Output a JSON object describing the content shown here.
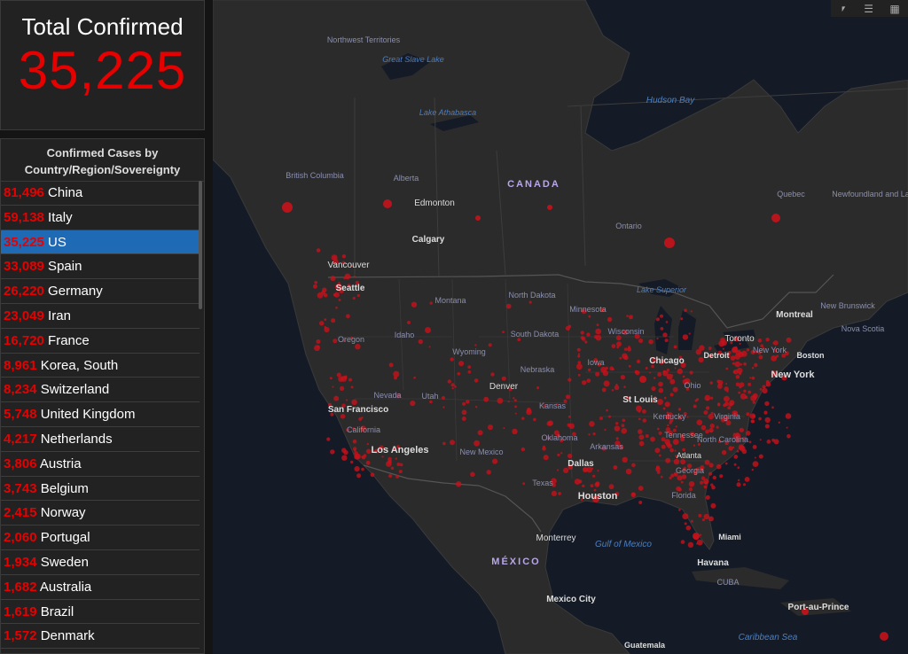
{
  "total": {
    "title": "Total Confirmed",
    "value": "35,225"
  },
  "list": {
    "header": "Confirmed Cases by Country/Region/Sovereignty",
    "rows": [
      {
        "value": "81,496",
        "name": "China"
      },
      {
        "value": "59,138",
        "name": "Italy"
      },
      {
        "value": "35,225",
        "name": "US"
      },
      {
        "value": "33,089",
        "name": "Spain"
      },
      {
        "value": "26,220",
        "name": "Germany"
      },
      {
        "value": "23,049",
        "name": "Iran"
      },
      {
        "value": "16,720",
        "name": "France"
      },
      {
        "value": "8,961",
        "name": "Korea, South"
      },
      {
        "value": "8,234",
        "name": "Switzerland"
      },
      {
        "value": "5,748",
        "name": "United Kingdom"
      },
      {
        "value": "4,217",
        "name": "Netherlands"
      },
      {
        "value": "3,806",
        "name": "Austria"
      },
      {
        "value": "3,743",
        "name": "Belgium"
      },
      {
        "value": "2,415",
        "name": "Norway"
      },
      {
        "value": "2,060",
        "name": "Portugal"
      },
      {
        "value": "1,934",
        "name": "Sweden"
      },
      {
        "value": "1,682",
        "name": "Australia"
      },
      {
        "value": "1,619",
        "name": "Brazil"
      },
      {
        "value": "1,572",
        "name": "Denmark"
      }
    ],
    "selected": "US"
  },
  "map": {
    "labels": {
      "northwest_territories": "Northwest Territories",
      "great_slave_lake": "Great Slave Lake",
      "lake_athabasca": "Lake Athabasca",
      "hudson_bay": "Hudson Bay",
      "canada": "CANADA",
      "british_columbia": "British Columbia",
      "alberta": "Alberta",
      "edmonton": "Edmonton",
      "calgary": "Calgary",
      "vancouver": "Vancouver",
      "seattle": "Seattle",
      "quebec": "Quebec",
      "newfoundland": "Newfoundland and Labrador",
      "ontario": "Ontario",
      "lake_superior": "Lake Superior",
      "north_dakota": "North Dakota",
      "montana": "Montana",
      "minnesota": "Minnesota",
      "oregon": "Oregon",
      "idaho": "Idaho",
      "south_dakota": "South Dakota",
      "wisconsin": "Wisconsin",
      "wyoming": "Wyoming",
      "montreal": "Montreal",
      "new_brunswick": "New Brunswick",
      "nova_scotia": "Nova Scotia",
      "toronto": "Toronto",
      "chicago": "Chicago",
      "detroit": "Detroit",
      "new_york_state": "New York",
      "boston": "Boston",
      "iowa": "Iowa",
      "nebraska": "Nebraska",
      "ohio": "Ohio",
      "new_york_city": "New York",
      "nevada": "Nevada",
      "utah": "Utah",
      "denver": "Denver",
      "st_louis": "St Louis",
      "kansas": "Kansas",
      "kentucky": "Kentucky",
      "virginia": "Virginia",
      "san_francisco": "San Francisco",
      "california": "California",
      "tennessee": "Tennessee",
      "north_carolina": "North Carolina",
      "oklahoma": "Oklahoma",
      "arkansas": "Arkansas",
      "los_angeles": "Los Angeles",
      "new_mexico": "New Mexico",
      "dallas": "Dallas",
      "atlanta": "Atlanta",
      "georgia": "Georgia",
      "texas": "Texas",
      "houston": "Houston",
      "florida": "Florida",
      "monterrey": "Monterrey",
      "gulf_of_mexico": "Gulf of Mexico",
      "miami": "Miami",
      "mexico": "MÉXICO",
      "havana": "Havana",
      "cuba": "CUBA",
      "mexico_city": "Mexico City",
      "port_au_prince": "Port-au-Prince",
      "caribbean_sea": "Caribbean Sea",
      "guatemala": "Guatemala"
    }
  },
  "colors": {
    "accent": "#e60000",
    "selected": "#1f6ab5",
    "map_land": "#2b2b2b",
    "map_water": "#141b26"
  }
}
